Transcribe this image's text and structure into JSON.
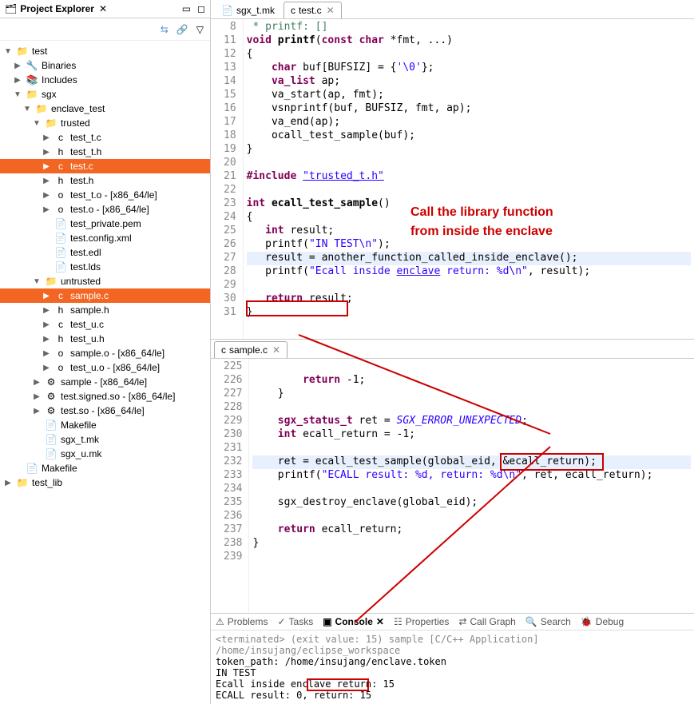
{
  "sidebar": {
    "title": "Project Explorer",
    "tree": [
      {
        "ind": 0,
        "arrow": "▼",
        "icon": "📁",
        "label": "test"
      },
      {
        "ind": 1,
        "arrow": "▶",
        "icon": "🔧",
        "label": "Binaries"
      },
      {
        "ind": 1,
        "arrow": "▶",
        "icon": "📚",
        "label": "Includes"
      },
      {
        "ind": 1,
        "arrow": "▼",
        "icon": "📁",
        "label": "sgx"
      },
      {
        "ind": 2,
        "arrow": "▼",
        "icon": "📁",
        "label": "enclave_test"
      },
      {
        "ind": 3,
        "arrow": "▼",
        "icon": "📁",
        "label": "trusted"
      },
      {
        "ind": 4,
        "arrow": "▶",
        "icon": "c",
        "label": "test_t.c"
      },
      {
        "ind": 4,
        "arrow": "▶",
        "icon": "h",
        "label": "test_t.h"
      },
      {
        "ind": 4,
        "arrow": "▶",
        "icon": "c",
        "label": "test.c",
        "selected": true
      },
      {
        "ind": 4,
        "arrow": "▶",
        "icon": "h",
        "label": "test.h"
      },
      {
        "ind": 4,
        "arrow": "▶",
        "icon": "o",
        "label": "test_t.o - [x86_64/le]"
      },
      {
        "ind": 4,
        "arrow": "▶",
        "icon": "o",
        "label": "test.o - [x86_64/le]"
      },
      {
        "ind": 4,
        "arrow": "",
        "icon": "📄",
        "label": "test_private.pem"
      },
      {
        "ind": 4,
        "arrow": "",
        "icon": "📄",
        "label": "test.config.xml"
      },
      {
        "ind": 4,
        "arrow": "",
        "icon": "📄",
        "label": "test.edl"
      },
      {
        "ind": 4,
        "arrow": "",
        "icon": "📄",
        "label": "test.lds"
      },
      {
        "ind": 3,
        "arrow": "▼",
        "icon": "📁",
        "label": "untrusted"
      },
      {
        "ind": 4,
        "arrow": "▶",
        "icon": "c",
        "label": "sample.c",
        "selected": true
      },
      {
        "ind": 4,
        "arrow": "▶",
        "icon": "h",
        "label": "sample.h"
      },
      {
        "ind": 4,
        "arrow": "▶",
        "icon": "c",
        "label": "test_u.c"
      },
      {
        "ind": 4,
        "arrow": "▶",
        "icon": "h",
        "label": "test_u.h"
      },
      {
        "ind": 4,
        "arrow": "▶",
        "icon": "o",
        "label": "sample.o - [x86_64/le]"
      },
      {
        "ind": 4,
        "arrow": "▶",
        "icon": "o",
        "label": "test_u.o - [x86_64/le]"
      },
      {
        "ind": 3,
        "arrow": "▶",
        "icon": "⚙",
        "label": "sample - [x86_64/le]"
      },
      {
        "ind": 3,
        "arrow": "▶",
        "icon": "⚙",
        "label": "test.signed.so - [x86_64/le]"
      },
      {
        "ind": 3,
        "arrow": "▶",
        "icon": "⚙",
        "label": "test.so - [x86_64/le]"
      },
      {
        "ind": 3,
        "arrow": "",
        "icon": "📄",
        "label": "Makefile"
      },
      {
        "ind": 3,
        "arrow": "",
        "icon": "📄",
        "label": "sgx_t.mk"
      },
      {
        "ind": 3,
        "arrow": "",
        "icon": "📄",
        "label": "sgx_u.mk"
      },
      {
        "ind": 1,
        "arrow": "",
        "icon": "📄",
        "label": "Makefile"
      },
      {
        "ind": 0,
        "arrow": "▶",
        "icon": "📁",
        "label": "test_lib"
      }
    ]
  },
  "topTabs": [
    {
      "icon": "📄",
      "label": "sgx_t.mk",
      "active": false
    },
    {
      "icon": "c",
      "label": "test.c",
      "active": true
    }
  ],
  "editor1": {
    "lines": [
      {
        "n": 8,
        "html": " * printf: []",
        "cls": "com"
      },
      {
        "n": 11,
        "html": "<span class='kw'>void</span> <b>printf</b>(<span class='kw'>const</span> <span class='kw'>char</span> *fmt, ...)"
      },
      {
        "n": 12,
        "html": "{"
      },
      {
        "n": 13,
        "html": "    <span class='kw'>char</span> buf[BUFSIZ] = {<span class='str'>'\\0'</span>};"
      },
      {
        "n": 14,
        "html": "    <span class='kw'>va_list</span> ap;"
      },
      {
        "n": 15,
        "html": "    va_start(ap, fmt);"
      },
      {
        "n": 16,
        "html": "    vsnprintf(buf, BUFSIZ, fmt, ap);"
      },
      {
        "n": 17,
        "html": "    va_end(ap);"
      },
      {
        "n": 18,
        "html": "    ocall_test_sample(buf);"
      },
      {
        "n": 19,
        "html": "}"
      },
      {
        "n": 20,
        "html": ""
      },
      {
        "n": 21,
        "html": "<span class='kw'>#include</span> <span class='inc'>\"trusted_t.h\"</span>"
      },
      {
        "n": 22,
        "html": ""
      },
      {
        "n": 23,
        "html": "<span class='kw'>int</span> <b>ecall_test_sample</b>()"
      },
      {
        "n": 24,
        "html": "{"
      },
      {
        "n": 25,
        "html": "   <span class='kw'>int</span> result;"
      },
      {
        "n": 26,
        "html": "   printf(<span class='str'>\"IN TEST\\n\"</span>);"
      },
      {
        "n": 27,
        "html": "   result = another_function_called_inside_enclave();",
        "hl": true
      },
      {
        "n": 28,
        "html": "   printf(<span class='str'>\"Ecall inside <u>enclave</u> return: %d\\n\"</span>, result);"
      },
      {
        "n": 29,
        "html": ""
      },
      {
        "n": 30,
        "html": "   <span class='kw'>return</span> result;"
      },
      {
        "n": 31,
        "html": "}"
      }
    ]
  },
  "midTabs": [
    {
      "icon": "c",
      "label": "sample.c",
      "active": true
    }
  ],
  "editor2": {
    "lines": [
      {
        "n": 225,
        "html": ""
      },
      {
        "n": 226,
        "html": "        <span class='kw'>return</span> -1;"
      },
      {
        "n": 227,
        "html": "    }"
      },
      {
        "n": 228,
        "html": ""
      },
      {
        "n": 229,
        "html": "    <span class='kw'>sgx_status_t</span> ret = <span class='mstr'>SGX_ERROR_UNEXPECTED</span>;"
      },
      {
        "n": 230,
        "html": "    <span class='kw'>int</span> ecall_return = -1;"
      },
      {
        "n": 231,
        "html": ""
      },
      {
        "n": 232,
        "html": "    ret = ecall_test_sample(global_eid, &ecall_return);",
        "hl": true
      },
      {
        "n": 233,
        "html": "    printf(<span class='str'>\"ECALL result: %d, return: %d\\n\"</span>, ret, ecall_return);"
      },
      {
        "n": 234,
        "html": ""
      },
      {
        "n": 235,
        "html": "    sgx_destroy_enclave(global_eid);"
      },
      {
        "n": 236,
        "html": ""
      },
      {
        "n": 237,
        "html": "    <span class='kw'>return</span> ecall_return;"
      },
      {
        "n": 238,
        "html": "}"
      },
      {
        "n": 239,
        "html": ""
      }
    ]
  },
  "consoleTabs": {
    "problems": "Problems",
    "tasks": "Tasks",
    "console": "Console",
    "properties": "Properties",
    "callgraph": "Call Graph",
    "search": "Search",
    "debug": "Debug"
  },
  "console": {
    "term": "<terminated> (exit value: 15) sample [C/C++ Application] /home/insujang/eclipse_workspace",
    "lines": [
      "token_path: /home/insujang/enclave.token",
      "IN TEST",
      "Ecall inside enclave return: 15",
      "ECALL result: 0, return: 15"
    ]
  },
  "annotation": {
    "text1": "Call the library function",
    "text2": "from inside the enclave"
  }
}
